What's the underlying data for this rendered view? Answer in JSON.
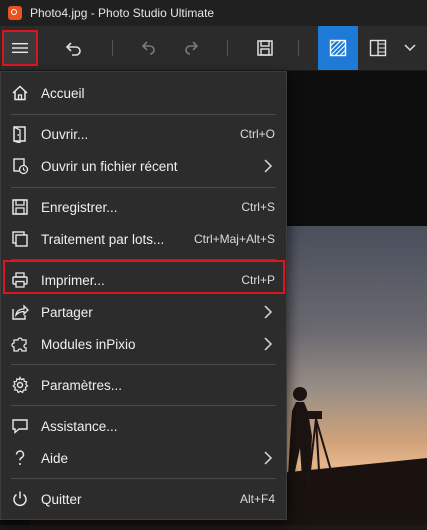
{
  "window": {
    "title": "Photo4.jpg - Photo Studio Ultimate"
  },
  "colors": {
    "accent": "#1e7ad6",
    "highlight": "#e0141e",
    "app_icon": "#e8531f"
  },
  "toolbar": {
    "buttons": [
      "hamburger-menu",
      "undo",
      "redo-disabled-1",
      "redo-disabled-2",
      "save",
      "compare-view",
      "split-view",
      "more-dropdown"
    ]
  },
  "menu": {
    "items": [
      {
        "label": "Accueil",
        "shortcut": "",
        "icon": "home-icon"
      },
      {
        "label": "Ouvrir...",
        "shortcut": "Ctrl+O",
        "icon": "open-icon"
      },
      {
        "label": "Ouvrir un fichier récent",
        "shortcut": "",
        "icon": "recent-icon",
        "submenu": true
      },
      {
        "label": "Enregistrer...",
        "shortcut": "Ctrl+S",
        "icon": "save-icon"
      },
      {
        "label": "Traitement par lots...",
        "shortcut": "Ctrl+Maj+Alt+S",
        "icon": "batch-icon"
      },
      {
        "label": "Imprimer...",
        "shortcut": "Ctrl+P",
        "icon": "print-icon"
      },
      {
        "label": "Partager",
        "shortcut": "",
        "icon": "share-icon",
        "submenu": true
      },
      {
        "label": "Modules inPixio",
        "shortcut": "",
        "icon": "puzzle-icon",
        "submenu": true
      },
      {
        "label": "Paramètres...",
        "shortcut": "",
        "icon": "gear-icon"
      },
      {
        "label": "Assistance...",
        "shortcut": "",
        "icon": "chat-icon"
      },
      {
        "label": "Aide",
        "shortcut": "",
        "icon": "question-icon",
        "submenu": true
      },
      {
        "label": "Quitter",
        "shortcut": "Alt+F4",
        "icon": "power-icon"
      }
    ]
  }
}
